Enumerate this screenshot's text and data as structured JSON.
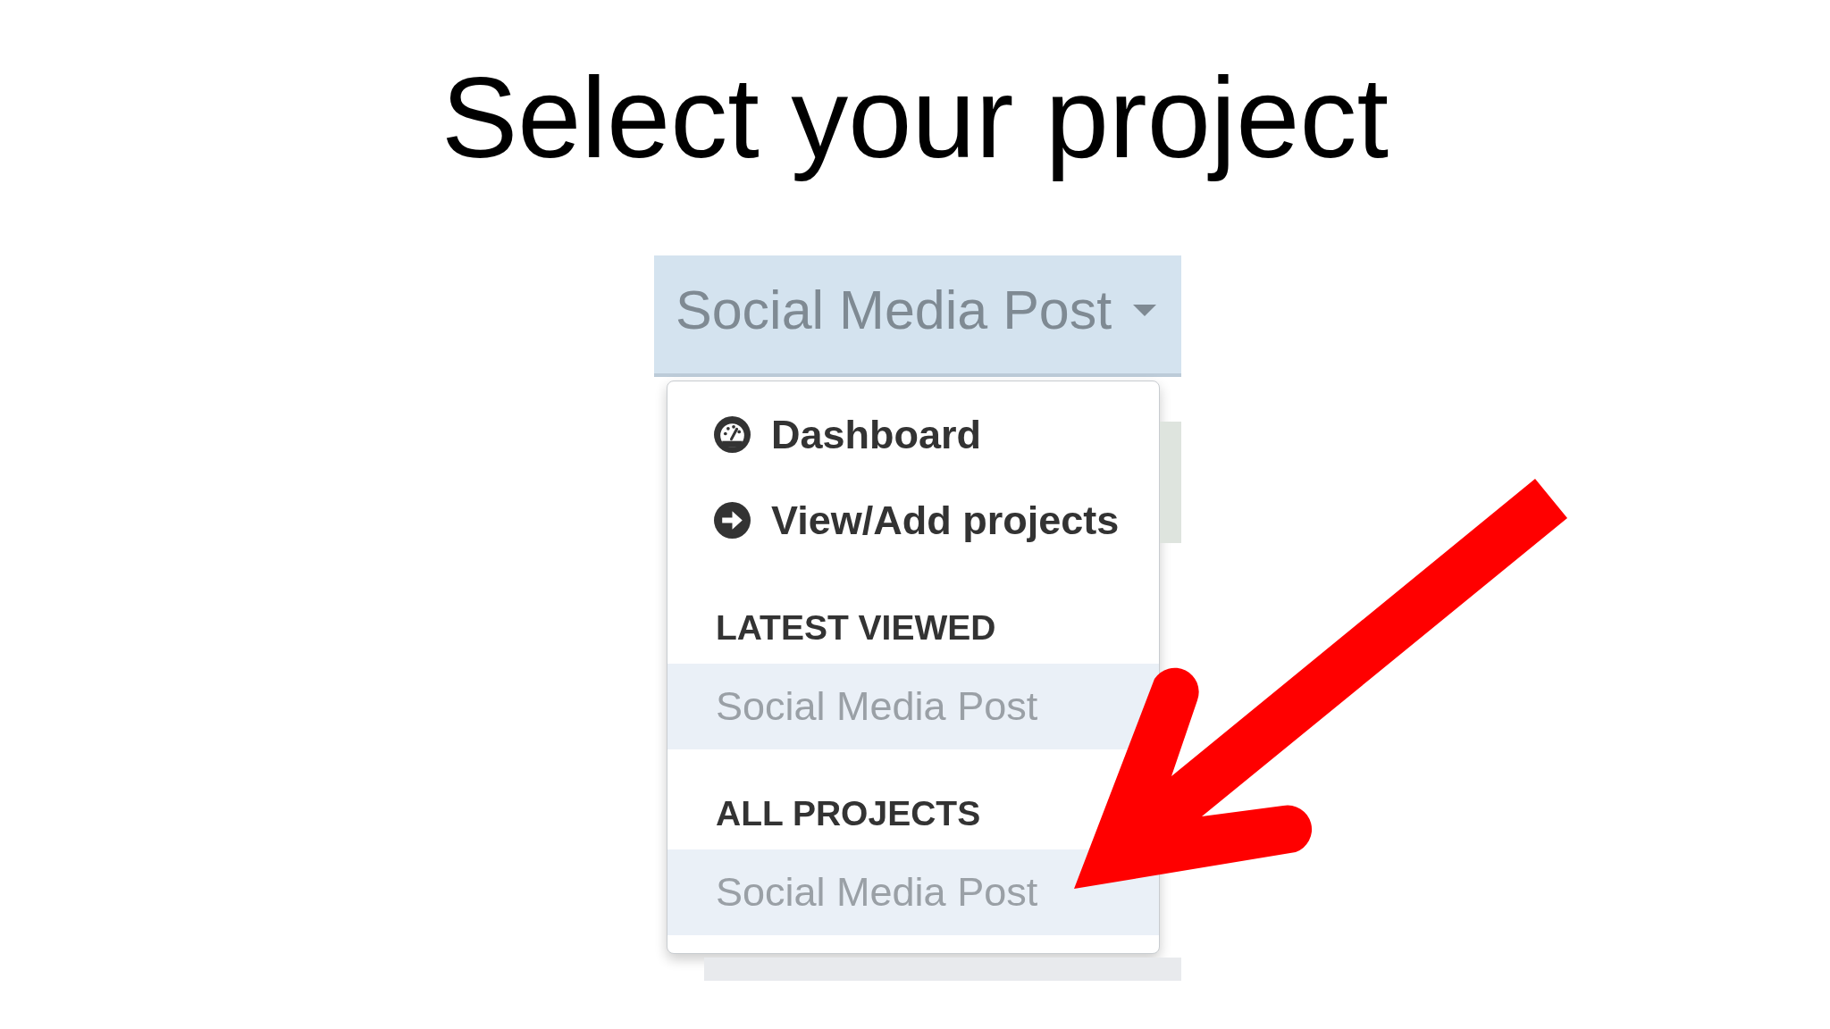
{
  "title": "Select your project",
  "project_button": {
    "label": "Social Media Post",
    "expanded": true
  },
  "menu": {
    "links": [
      {
        "kind": "dashboard",
        "label": "Dashboard"
      },
      {
        "kind": "projects",
        "label": "View/Add projects"
      }
    ],
    "sections": [
      {
        "heading": "LATEST VIEWED",
        "items": [
          {
            "label": "Social Media Post",
            "selected": true
          }
        ]
      },
      {
        "heading": "ALL PROJECTS",
        "items": [
          {
            "label": "Social Media Post",
            "selected": true
          }
        ]
      }
    ]
  }
}
